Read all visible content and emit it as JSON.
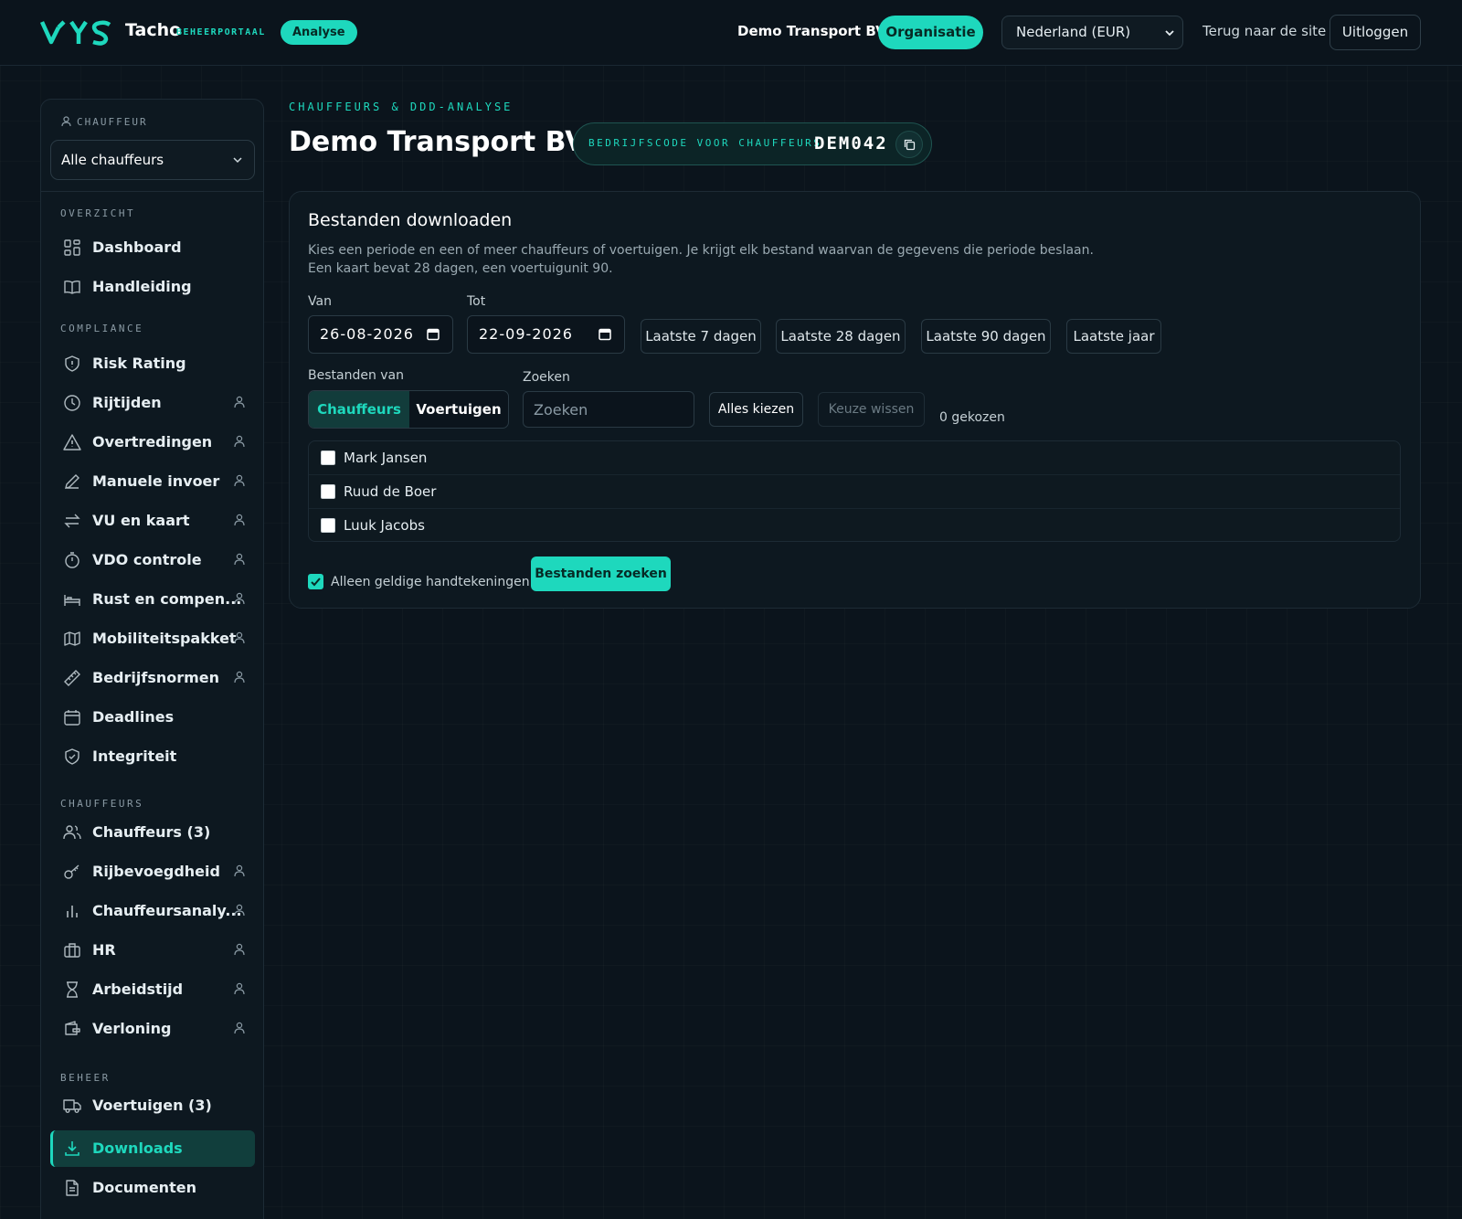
{
  "header": {
    "brand_name": "Tacho",
    "brand_sub": "BEHEERPORTAAL",
    "mode_badge": "Analyse",
    "organization": "Demo Transport BV",
    "org_button": "Organisatie",
    "country_select": "Nederland (EUR)",
    "back_link": "Terug naar de site",
    "logout": "Uitloggen"
  },
  "sidebar": {
    "driver_label": "CHAUFFEUR",
    "driver_select": "Alle chauffeurs",
    "sections": {
      "overzicht": "OVERZICHT",
      "compliance": "COMPLIANCE",
      "chauffeurs": "CHAUFFEURS",
      "beheer": "BEHEER"
    },
    "items": [
      {
        "label": "Dashboard",
        "icon": "grid-icon"
      },
      {
        "label": "Handleiding",
        "icon": "book-icon"
      },
      {
        "label": "Risk Rating",
        "icon": "shield-alert-icon"
      },
      {
        "label": "Rijtijden",
        "icon": "clock-icon"
      },
      {
        "label": "Overtredingen",
        "icon": "warning-icon"
      },
      {
        "label": "Manuele invoer",
        "icon": "pencil-icon"
      },
      {
        "label": "VU en kaart",
        "icon": "swap-icon"
      },
      {
        "label": "VDO controle",
        "icon": "stopwatch-icon"
      },
      {
        "label": "Rust en compen...",
        "icon": "bed-icon"
      },
      {
        "label": "Mobiliteitspakket",
        "icon": "map-icon"
      },
      {
        "label": "Bedrijfsnormen",
        "icon": "ruler-icon"
      },
      {
        "label": "Deadlines",
        "icon": "calendar-icon"
      },
      {
        "label": "Integriteit",
        "icon": "shield-check-icon"
      },
      {
        "label": "Chauffeurs (3)",
        "icon": "users-icon"
      },
      {
        "label": "Rijbevoegdheid",
        "icon": "key-icon"
      },
      {
        "label": "Chauffeursanaly...",
        "icon": "bar-chart-icon"
      },
      {
        "label": "HR",
        "icon": "briefcase-icon"
      },
      {
        "label": "Arbeidstijd",
        "icon": "hourglass-icon"
      },
      {
        "label": "Verloning",
        "icon": "wallet-icon"
      },
      {
        "label": "Voertuigen (3)",
        "icon": "truck-icon"
      },
      {
        "label": "Downloads",
        "icon": "download-icon"
      },
      {
        "label": "Documenten",
        "icon": "document-icon"
      }
    ]
  },
  "main": {
    "breadcrumb": "CHAUFFEURS & DDD-ANALYSE",
    "title": "Demo Transport BV",
    "code_label": "BEDRIJFSCODE VOOR CHAUFFEURS",
    "code_value": "DEM042",
    "card": {
      "title": "Bestanden downloaden",
      "desc_line1": "Kies een periode en een of meer chauffeurs of voertuigen. Je krijgt elk bestand waarvan de gegevens die periode beslaan.",
      "desc_line2": "Een kaart bevat 28 dagen, een voertuigunit 90.",
      "from_label": "Van",
      "from_value": "26-08-2026",
      "to_label": "Tot",
      "to_value": "22-09-2026",
      "quick": [
        "Laatste 7 dagen",
        "Laatste 28 dagen",
        "Laatste 90 dagen",
        "Laatste jaar"
      ],
      "files_from_label": "Bestanden van",
      "seg_a": "Chauffeurs",
      "seg_b": "Voertuigen",
      "search_label": "Zoeken",
      "search_placeholder": "Zoeken",
      "select_all": "Alles kiezen",
      "clear_selection": "Keuze wissen",
      "selected_count": "0 gekozen",
      "drivers": [
        "Mark Jansen",
        "Ruud de Boer",
        "Luuk Jacobs"
      ],
      "valid_only": "Alleen geldige handtekeningen",
      "search_files": "Bestanden zoeken"
    }
  },
  "colors": {
    "accent": "#1ed8bd",
    "background": "#0b141c",
    "panel": "#0d1820"
  }
}
